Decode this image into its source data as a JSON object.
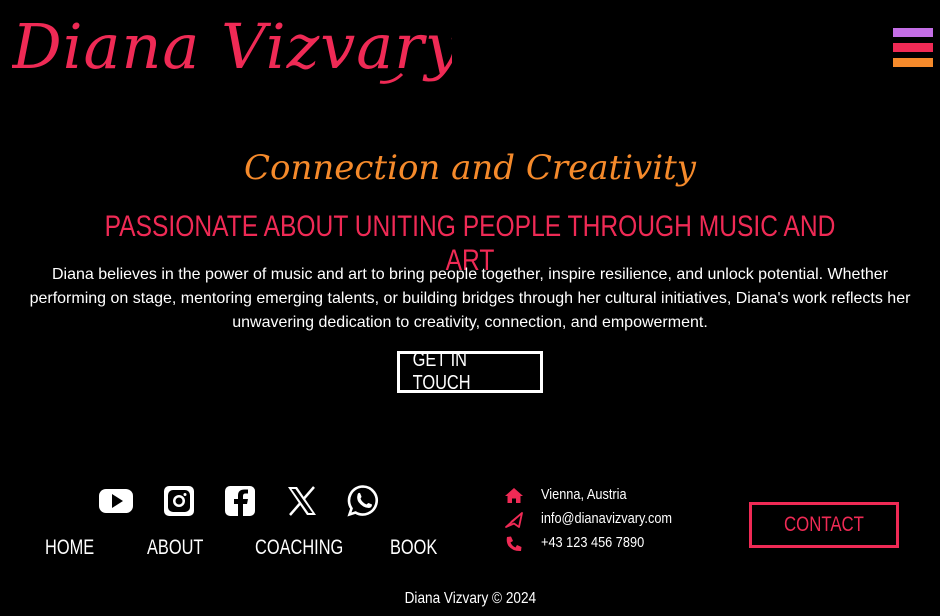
{
  "brand": {
    "name": "Diana Vizvary",
    "accent": "#ef2a55",
    "accent2": "#f58a2b",
    "accent3": "#c46ee6"
  },
  "menu": {
    "icon": "hamburger-menu-icon"
  },
  "hero": {
    "tagline": "Connection and Creativity",
    "headline": "PASSIONATE ABOUT UNITING PEOPLE THROUGH MUSIC AND ART",
    "bio": "Diana believes in the power of music and art to bring people together, inspire resilience, and unlock potential. Whether performing on stage, mentoring emerging talents, or building bridges through her cultural initiatives, Diana's work reflects her unwavering dedication to creativity, connection, and empowerment.",
    "cta": "GET IN TOUCH"
  },
  "social": [
    "youtube-icon",
    "instagram-icon",
    "facebook-icon",
    "x-icon",
    "whatsapp-icon"
  ],
  "footer_nav": {
    "home": "HOME",
    "about": "ABOUT",
    "coaching": "COACHING",
    "book": "BOOK"
  },
  "contact_info": {
    "location": "Vienna, Austria",
    "email": "info@dianavizvary.com",
    "phone": "+43 123 456 7890"
  },
  "contact_button": "CONTACT",
  "copyright": "Diana Vizvary © 2024"
}
